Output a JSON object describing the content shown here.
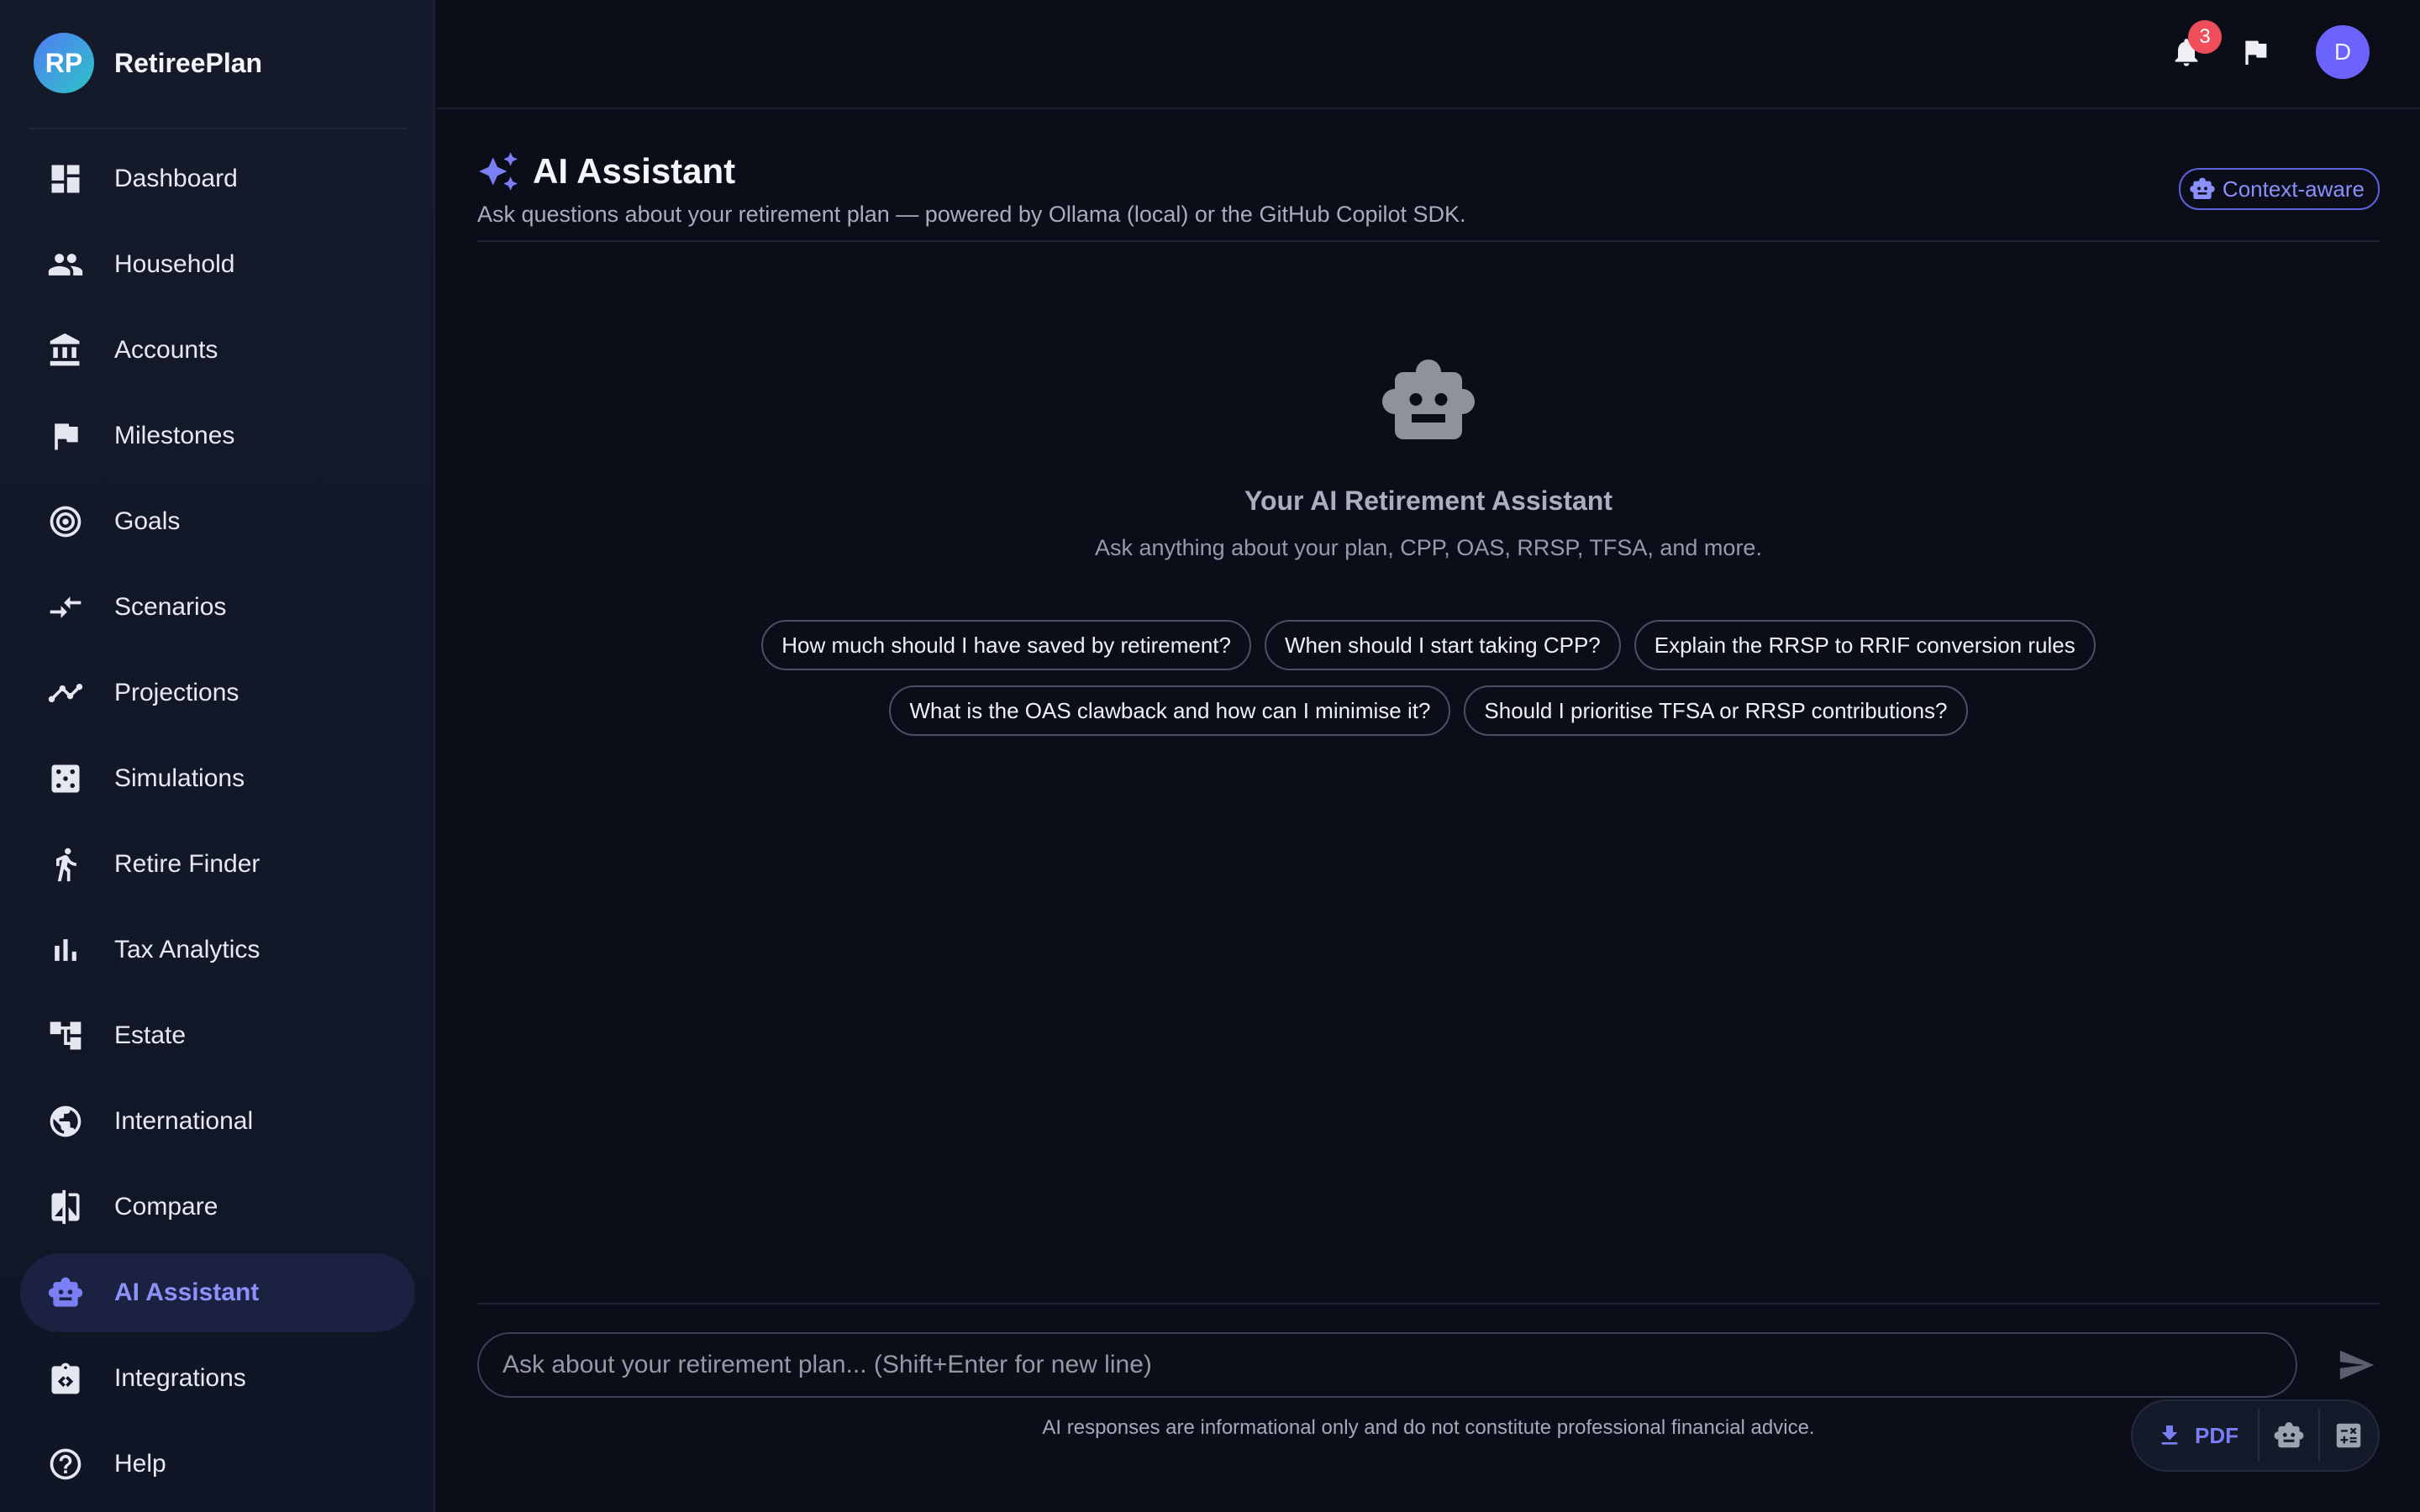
{
  "app": {
    "logo_initials": "RP",
    "brand_name": "RetireePlan"
  },
  "sidebar": {
    "items": [
      {
        "label": "Dashboard",
        "icon": "dashboard-icon"
      },
      {
        "label": "Household",
        "icon": "people-icon"
      },
      {
        "label": "Accounts",
        "icon": "bank-icon"
      },
      {
        "label": "Milestones",
        "icon": "flag-icon"
      },
      {
        "label": "Goals",
        "icon": "target-icon"
      },
      {
        "label": "Scenarios",
        "icon": "compare-arrows-icon"
      },
      {
        "label": "Projections",
        "icon": "trend-line-icon"
      },
      {
        "label": "Simulations",
        "icon": "dice-icon"
      },
      {
        "label": "Retire Finder",
        "icon": "walking-person-icon"
      },
      {
        "label": "Tax Analytics",
        "icon": "bar-chart-icon"
      },
      {
        "label": "Estate",
        "icon": "account-tree-icon"
      },
      {
        "label": "International",
        "icon": "globe-icon"
      },
      {
        "label": "Compare",
        "icon": "compare-icon"
      },
      {
        "label": "AI Assistant",
        "icon": "robot-icon",
        "active": true
      },
      {
        "label": "Integrations",
        "icon": "integration-icon"
      },
      {
        "label": "Help",
        "icon": "help-icon"
      }
    ]
  },
  "topbar": {
    "notification_count": "3",
    "avatar_initial": "D"
  },
  "header": {
    "title": "AI Assistant",
    "subtitle": "Ask questions about your retirement plan — powered by Ollama (local) or the GitHub Copilot SDK.",
    "context_chip": "Context-aware"
  },
  "empty_state": {
    "title": "Your AI Retirement Assistant",
    "description": "Ask anything about your plan, CPP, OAS, RRSP, TFSA, and more."
  },
  "suggestions": [
    "How much should I have saved by retirement?",
    "When should I start taking CPP?",
    "Explain the RRSP to RRIF conversion rules",
    "What is the OAS clawback and how can I minimise it?",
    "Should I prioritise TFSA or RRSP contributions?"
  ],
  "chat": {
    "placeholder": "Ask about your retirement plan... (Shift+Enter for new line)",
    "value": "",
    "disclaimer": "AI responses are informational only and do not constitute professional financial advice."
  },
  "fab": {
    "pdf_label": "PDF"
  },
  "colors": {
    "accent": "#7b7ff6",
    "background": "#0b0e18",
    "sidebar": "#141a2a",
    "badge": "#ef4d5a",
    "avatar": "#6c63ff"
  }
}
